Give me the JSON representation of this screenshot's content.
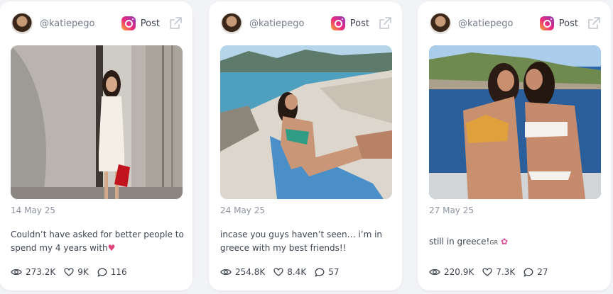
{
  "colors": {
    "background": "#f2f3f6",
    "card": "#ffffff",
    "text": "#3e4451",
    "muted": "#8e94a1",
    "instagram_gradient": [
      "#f9b233",
      "#ee2a7b",
      "#8a3ab9"
    ]
  },
  "posts": [
    {
      "handle": "@katiepego",
      "platform_icon": "instagram-icon",
      "type_label": "Post",
      "date": "14 May 25",
      "caption": "Couldn’t have asked for better people to spend my 4 years with",
      "caption_emoji": "♥",
      "views": "273.2K",
      "likes": "9K",
      "comments": "116"
    },
    {
      "handle": "@katiepego",
      "platform_icon": "instagram-icon",
      "type_label": "Post",
      "date": "24 May 25",
      "caption": "incase you guys haven’t seen… i’m in greece with my best friends!!",
      "views": "254.8K",
      "likes": "8.4K",
      "comments": "57"
    },
    {
      "handle": "@katiepego",
      "platform_icon": "instagram-icon",
      "type_label": "Post",
      "date": "27 May 25",
      "caption": "still in greece!",
      "caption_flag": "GR",
      "caption_emoji": "✿",
      "views": "220.9K",
      "likes": "7.3K",
      "comments": "27"
    }
  ]
}
